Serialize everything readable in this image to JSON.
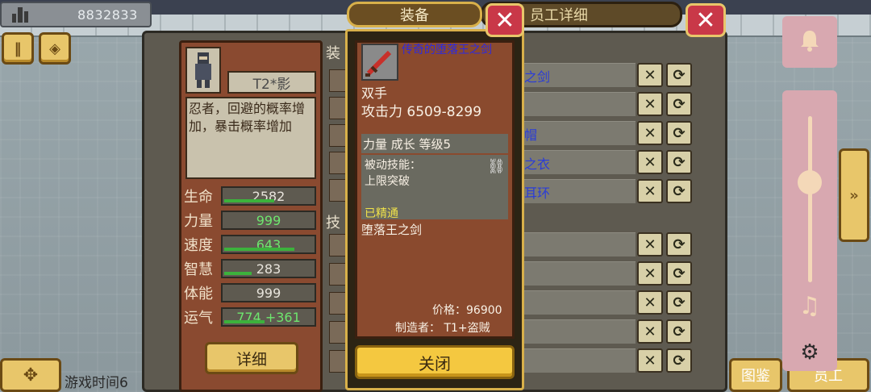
{
  "hud": {
    "money": "8832833",
    "game_time": "游戏时间6"
  },
  "character": {
    "name": "T2*影",
    "description": "忍者，回避的概率增加，暴击概率增加",
    "stats": [
      {
        "label": "生命",
        "value": "2582",
        "highlight": false,
        "fill": 0.55
      },
      {
        "label": "力量",
        "value": "999",
        "highlight": true,
        "fill": 0.0
      },
      {
        "label": "速度",
        "value": "643",
        "highlight": true,
        "fill": 0.78
      },
      {
        "label": "智慧",
        "value": "283",
        "highlight": false,
        "fill": 0.3
      },
      {
        "label": "体能",
        "value": "999",
        "highlight": false,
        "fill": 0.0
      },
      {
        "label": "运气",
        "value": "774 +361",
        "highlight": true,
        "fill": 0.45
      }
    ],
    "detail_button": "详细"
  },
  "section_heads": {
    "equip": "装",
    "skill": "技"
  },
  "right_panel": {
    "title": "员工详细",
    "rows": [
      {
        "text": "之剑"
      },
      {
        "text": ""
      },
      {
        "text": "帽"
      },
      {
        "text": "之衣"
      },
      {
        "text": "耳环"
      },
      {
        "text": ""
      },
      {
        "text": ""
      },
      {
        "text": ""
      },
      {
        "text": ""
      },
      {
        "text": ""
      }
    ],
    "bottom_left": "图鉴",
    "bottom_right": "员工"
  },
  "equip_popup": {
    "tab": "装备",
    "item": {
      "name": "传奇的堕落王之剑",
      "hands": "双手",
      "attack": "攻击力  6509-8299",
      "growth": "力量  成长  等级5",
      "skill_title": "被动技能：",
      "skill_name": "上限突破",
      "mastered": "已精通",
      "flavor": "堕落王之剑",
      "price": "价格：96900",
      "maker": "制造者：  T1+盗贼"
    },
    "close_button": "关闭"
  },
  "settings": {
    "volume": 0.6
  },
  "colors": {
    "gold": "#e8c66a",
    "close_red": "#c93848",
    "item_name_blue": "#2d2ae0",
    "mastered_yellow": "#f0e24a"
  }
}
